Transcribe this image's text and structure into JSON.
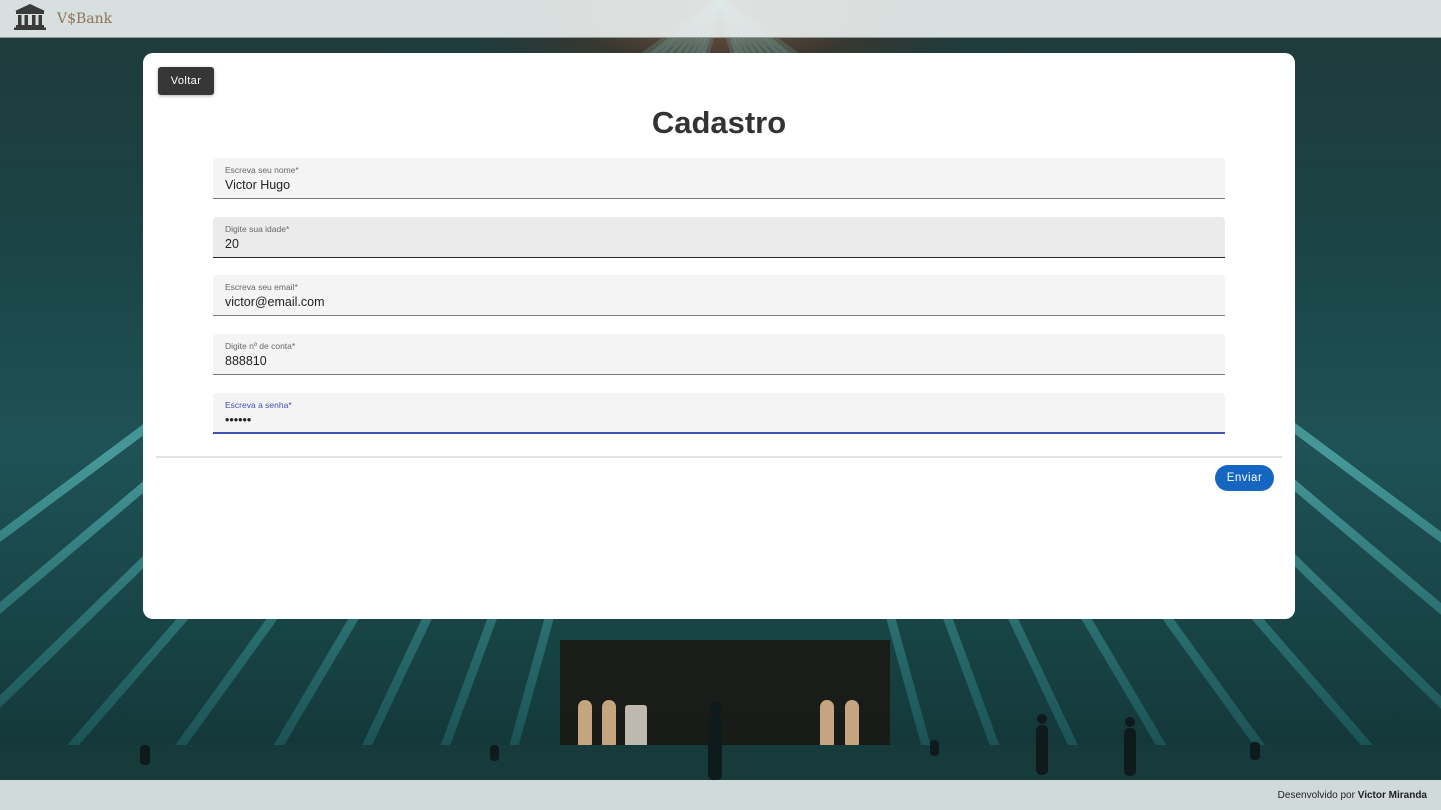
{
  "app": {
    "brand": "V$Bank"
  },
  "nav": {
    "back_label": "Voltar"
  },
  "form": {
    "title": "Cadastro",
    "fields": [
      {
        "label": "Escreva seu nome*",
        "value": "Victor Hugo"
      },
      {
        "label": "Digite sua idade*",
        "value": "20"
      },
      {
        "label": "Escreva seu email*",
        "value": "victor@email.com"
      },
      {
        "label": "Digite nº de conta*",
        "value": "888810"
      },
      {
        "label": "Escreva a senha*",
        "value": "••••••"
      }
    ],
    "submit_label": "Enviar"
  },
  "footer": {
    "prefix": "Desenvolvido por",
    "author": "Victor Miranda"
  },
  "colors": {
    "primary_button": "#1566c0",
    "back_button": "#363636",
    "focus_underline": "#3f51b5",
    "brand_text": "#8d7452"
  },
  "icons": {
    "logo": "bank-building-icon"
  }
}
